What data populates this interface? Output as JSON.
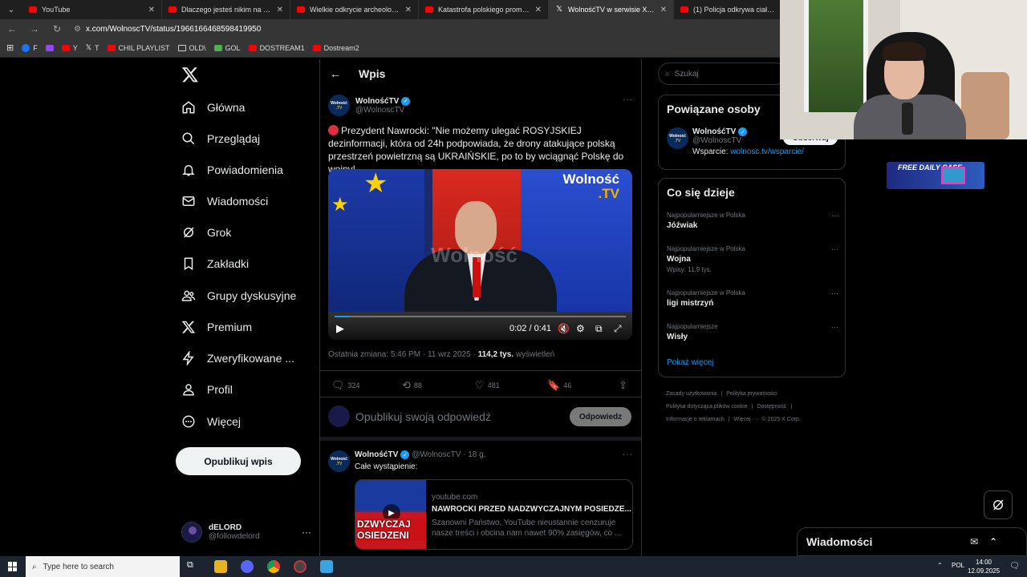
{
  "browser": {
    "tabs": [
      {
        "label": "YouTube",
        "icon": "youtube-icon",
        "active": false
      },
      {
        "label": "Dlaczego jesteś nikim na rynku",
        "icon": "youtube-icon",
        "active": false
      },
      {
        "label": "Wielkie odkrycie archeologiczne",
        "icon": "youtube-icon",
        "active": false
      },
      {
        "label": "Katastrofa polskiego promu \"Ja",
        "icon": "youtube-icon",
        "active": false
      },
      {
        "label": "WolnośćTV w serwisie X: „Pr",
        "icon": "x-icon",
        "active": true
      },
      {
        "label": "(1) Policja odkrywa ciała podcz",
        "icon": "youtube-icon",
        "active": false
      }
    ],
    "url": "x.com/WolnoscTV/status/1966166468598419950",
    "bookmarks": [
      {
        "label": "F",
        "icon": "facebook-icon"
      },
      {
        "label": "",
        "icon": "twitch-icon"
      },
      {
        "label": "Y",
        "icon": "youtube-icon"
      },
      {
        "label": "T",
        "icon": "x-icon"
      },
      {
        "label": "CHIL PLAYLIST",
        "icon": "youtube-icon"
      },
      {
        "label": "OLD\\",
        "icon": "folder-icon"
      },
      {
        "label": "GOL",
        "icon": "gol-icon"
      },
      {
        "label": "DOSTREAM1",
        "icon": "youtube-icon"
      },
      {
        "label": "Dostream2",
        "icon": "youtube-icon"
      }
    ]
  },
  "sidebar": {
    "items": [
      {
        "label": "Główna",
        "icon": "home-icon"
      },
      {
        "label": "Przeglądaj",
        "icon": "search-icon"
      },
      {
        "label": "Powiadomienia",
        "icon": "bell-icon"
      },
      {
        "label": "Wiadomości",
        "icon": "mail-icon"
      },
      {
        "label": "Grok",
        "icon": "grok-icon"
      },
      {
        "label": "Zakładki",
        "icon": "bookmark-icon"
      },
      {
        "label": "Grupy dyskusyjne",
        "icon": "people-icon"
      },
      {
        "label": "Premium",
        "icon": "x-icon"
      },
      {
        "label": "Zweryfikowane ...",
        "icon": "lightning-icon"
      },
      {
        "label": "Profil",
        "icon": "person-icon"
      },
      {
        "label": "Więcej",
        "icon": "more-circle-icon"
      }
    ],
    "post_button": "Opublikuj wpis",
    "account": {
      "name": "dELORD",
      "handle": "@followdelord"
    }
  },
  "main": {
    "header_title": "Wpis",
    "tweet": {
      "author_name": "WolnośćTV",
      "author_handle": "@WolnoscTV",
      "avatar_text_top": "Wolność",
      "avatar_text_bottom": ".TV",
      "text": "Prezydent Nawrocki: \"Nie możemy ulegać ROSYJSKIEJ dezinformacji, która od 24h podpowiada, że drony atakujące polską przestrzeń powietrzną są UKRAIŃSKIE, po to by wciągnąć Polskę do wojny!",
      "video": {
        "logo_top": "Wolność",
        "logo_bottom": ".TV",
        "watermark": "Wolność",
        "time": "0:02 / 0:41",
        "progress": 0.05
      },
      "meta_prefix": "Ostatnia zmiana: 5:46 PM · 11 wrz 2025 · ",
      "views_count": "114,2 tys.",
      "views_label": " wyświetleń",
      "replies": "324",
      "reposts": "88",
      "likes": "481",
      "bookmarks": "46"
    },
    "reply_placeholder": "Opublikuj swoją odpowiedź",
    "reply_button": "Odpowiedz",
    "reply_tweet": {
      "author_name": "WolnośćTV",
      "author_handle": "@WolnoscTV · 18 g.",
      "text": "Całe wystąpienie:",
      "card": {
        "domain": "youtube.com",
        "title": "NAWROCKI PRZED NADZWYCZAJNYM POSIEDZE...",
        "description": "Szanowni Państwo, YouTube nieustannie cenzuruje nasze treści i obcina nam nawet 90% zasięgów, co ...",
        "thumb_text": "DZWYCZAJ OSIEDZENI"
      }
    }
  },
  "right": {
    "search_placeholder": "Szukaj",
    "related_title": "Powiązane osoby",
    "related_person": {
      "name": "WolnośćTV",
      "handle": "@WolnoscTV",
      "follow_label": "Obserwuj",
      "support_label": "Wsparcie: ",
      "support_link": "wolnosc.tv/wsparcie/"
    },
    "trends_title": "Co się dzieje",
    "trends": [
      {
        "context": "Najpopularniejsze w Polska",
        "name": "Jóźwiak",
        "count": ""
      },
      {
        "context": "Najpopularniejsze w Polska",
        "name": "Wojna",
        "count": "Wpisy: 11,9 tys."
      },
      {
        "context": "Najpopularniejsze w Polska",
        "name": "ligi mistrzyń",
        "count": ""
      },
      {
        "context": "Najpopularniejsze",
        "name": "Wisły",
        "count": ""
      }
    ],
    "show_more": "Pokaż więcej",
    "footer": [
      "Zasady użytkowania",
      "|",
      "Polityka prywatności",
      "|",
      "Polityka dotycząca plików cookie",
      "|",
      "Dostępność",
      "|",
      "Informacje o reklamach",
      "|",
      "Więcej ···",
      "© 2025 X Corp."
    ],
    "messages_title": "Wiadomości",
    "ad_text": "FREE DAILY CASE"
  },
  "taskbar": {
    "search_placeholder": "Type here to search",
    "lang": "POL",
    "time": "14:00",
    "date": "12.09.2025"
  },
  "colors": {
    "accent": "#1d9bf0",
    "background": "#000000",
    "text": "#e7e9ea",
    "muted": "#71767b"
  }
}
